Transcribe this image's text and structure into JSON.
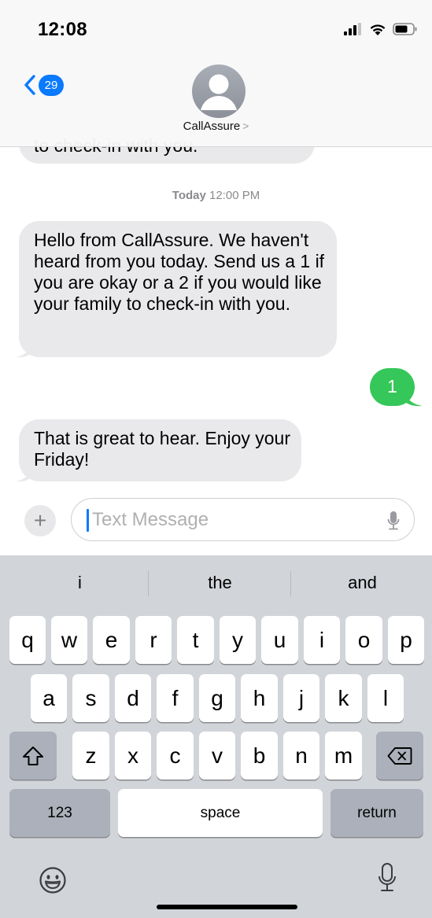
{
  "status_bar": {
    "time": "12:08"
  },
  "header": {
    "back_badge": "29",
    "contact_name": "CallAssure",
    "contact_chevron": ">"
  },
  "thread": {
    "partial_message": "to check-in with you.",
    "timestamp_day": "Today",
    "timestamp_time": "12:00 PM",
    "messages": [
      {
        "direction": "incoming",
        "text": "Hello from CallAssure. We haven't heard from you today. Send us a 1 if you are okay or a 2 if you would like your family to check-in with you."
      },
      {
        "direction": "outgoing",
        "text": "1"
      },
      {
        "direction": "incoming",
        "text": "That is great to hear. Enjoy your Friday!"
      }
    ]
  },
  "composer": {
    "plus": "+",
    "placeholder": "Text Message"
  },
  "keyboard": {
    "suggestions": [
      "i",
      "the",
      "and"
    ],
    "row1": [
      "q",
      "w",
      "e",
      "r",
      "t",
      "y",
      "u",
      "i",
      "o",
      "p"
    ],
    "row2": [
      "a",
      "s",
      "d",
      "f",
      "g",
      "h",
      "j",
      "k",
      "l"
    ],
    "row3": [
      "z",
      "x",
      "c",
      "v",
      "b",
      "n",
      "m"
    ],
    "numbers_key": "123",
    "space_key": "space",
    "return_key": "return",
    "icons": {
      "shift": "shift-icon",
      "delete": "delete-icon",
      "emoji": "emoji-icon",
      "dictation": "mic-icon"
    }
  },
  "colors": {
    "ios_blue": "#0a7aff",
    "imessage_green": "#35c759",
    "incoming_gray": "#e9e9eb",
    "keyboard_bg": "#d1d4d9"
  }
}
